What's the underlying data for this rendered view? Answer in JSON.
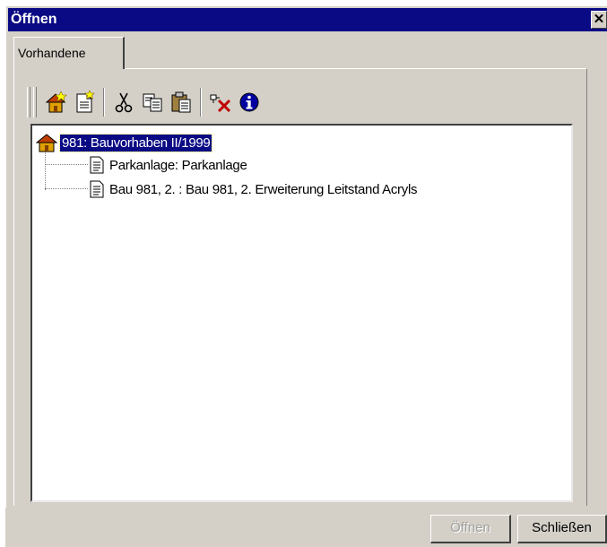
{
  "window": {
    "title": "Öffnen",
    "close_glyph": "✕"
  },
  "tabs": [
    {
      "label": "Vorhandene",
      "selected": true
    }
  ],
  "toolbar": {
    "buttons": [
      {
        "icon": "new-project-icon"
      },
      {
        "icon": "new-document-icon"
      },
      {
        "icon": "cut-icon"
      },
      {
        "icon": "copy-icon"
      },
      {
        "icon": "paste-icon"
      },
      {
        "icon": "delete-icon"
      },
      {
        "icon": "info-icon"
      }
    ]
  },
  "tree": {
    "root": {
      "icon": "house-icon",
      "label": "981: Bauvorhaben II/1999",
      "selected": true
    },
    "children": [
      {
        "icon": "document-icon",
        "label": "Parkanlage: Parkanlage"
      },
      {
        "icon": "document-icon",
        "label": "Bau 981, 2. : Bau 981, 2. Erweiterung Leitstand Acryls"
      }
    ]
  },
  "buttons": {
    "open_label": "Öffnen",
    "open_enabled": false,
    "close_label": "Schließen"
  },
  "colors": {
    "titlebar": "#0a0a84",
    "face": "#d4d0c8",
    "selection": "#0a0a84"
  }
}
